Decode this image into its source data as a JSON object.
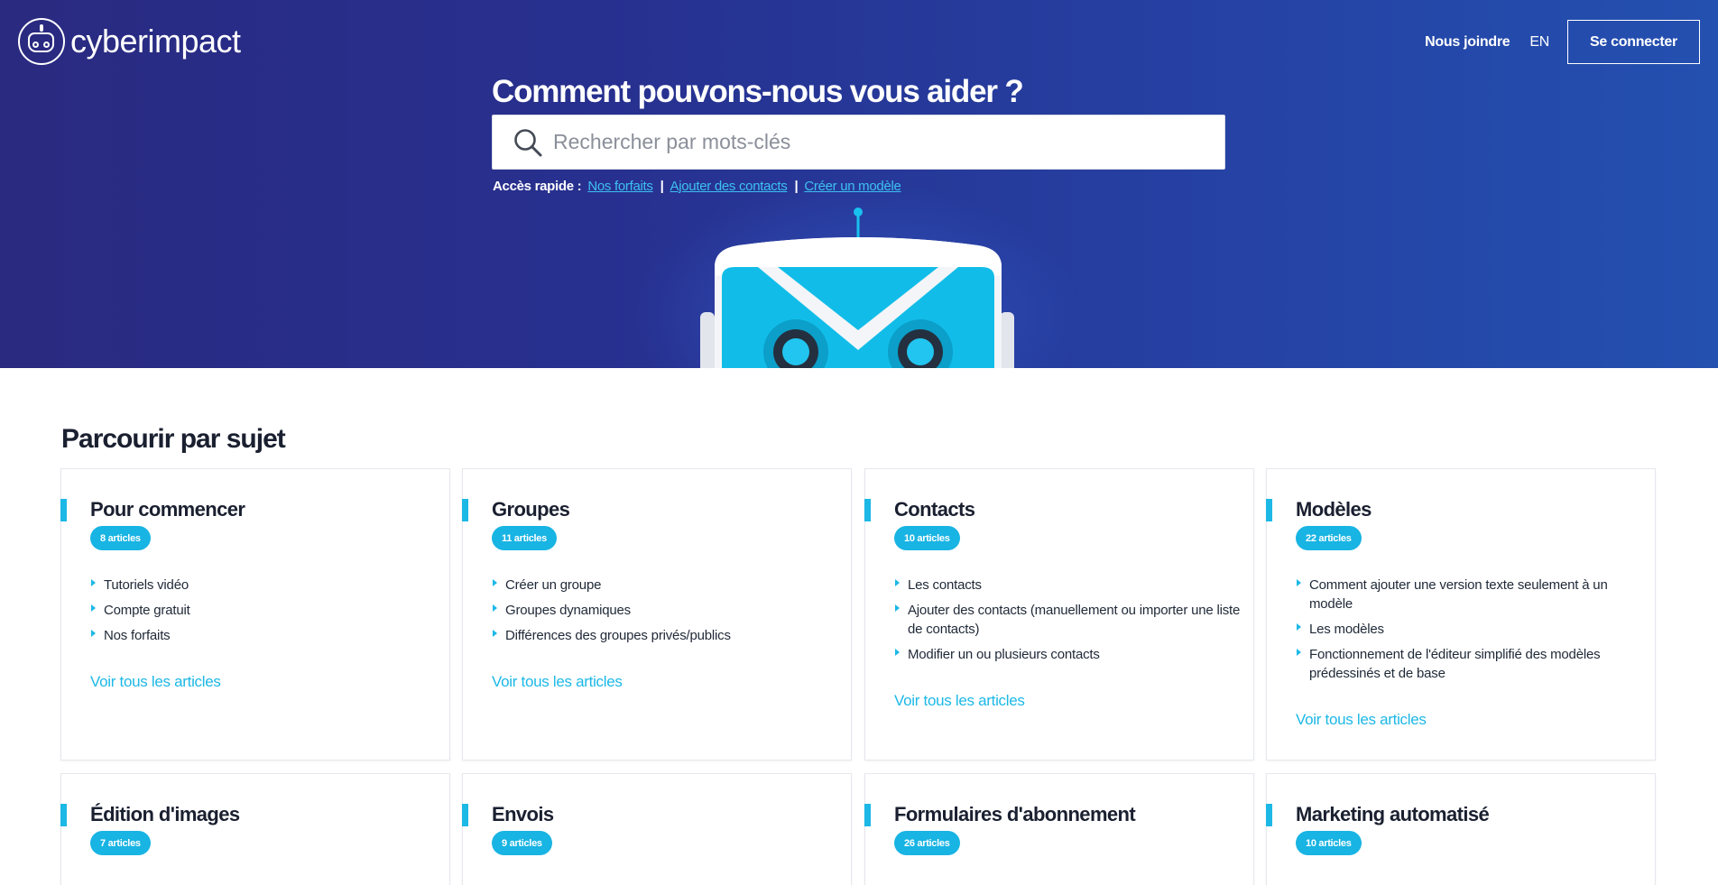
{
  "header": {
    "logo_text": "cyberimpact",
    "nav": {
      "contact": "Nous joindre",
      "lang": "EN",
      "login": "Se connecter"
    }
  },
  "hero": {
    "title": "Comment pouvons-nous vous aider ?",
    "search": {
      "placeholder": "Rechercher par mots-clés",
      "value": ""
    },
    "quick_access": {
      "label": "Accès rapide :",
      "separator": "|",
      "links": [
        "Nos forfaits",
        "Ajouter des contacts",
        "Créer un modèle"
      ]
    }
  },
  "browse": {
    "title": "Parcourir par sujet",
    "view_all": "Voir tous les articles",
    "topics": [
      {
        "title": "Pour commencer",
        "count": "8 articles",
        "articles": [
          "Tutoriels vidéo",
          "Compte gratuit",
          "Nos forfaits"
        ]
      },
      {
        "title": "Groupes",
        "count": "11 articles",
        "articles": [
          "Créer un groupe",
          "Groupes dynamiques",
          "Différences des groupes privés/publics"
        ]
      },
      {
        "title": "Contacts",
        "count": "10 articles",
        "articles": [
          "Les contacts",
          "Ajouter des contacts (manuellement ou importer une liste de contacts)",
          "Modifier un ou plusieurs contacts"
        ]
      },
      {
        "title": "Modèles",
        "count": "22 articles",
        "articles": [
          "Comment ajouter une version texte seulement à un modèle",
          "Les modèles",
          "Fonctionnement de l'éditeur simplifié des modèles prédessinés et de base"
        ]
      },
      {
        "title": "Édition d'images",
        "count": "7 articles",
        "articles": []
      },
      {
        "title": "Envois",
        "count": "9 articles",
        "articles": []
      },
      {
        "title": "Formulaires d'abonnement",
        "count": "26 articles",
        "articles": []
      },
      {
        "title": "Marketing automatisé",
        "count": "10 articles",
        "articles": []
      }
    ]
  },
  "colors": {
    "hero_start": "#2a2a80",
    "hero_end": "#2450b0",
    "accent": "#1cb8e6",
    "link": "#3ec0f0"
  }
}
